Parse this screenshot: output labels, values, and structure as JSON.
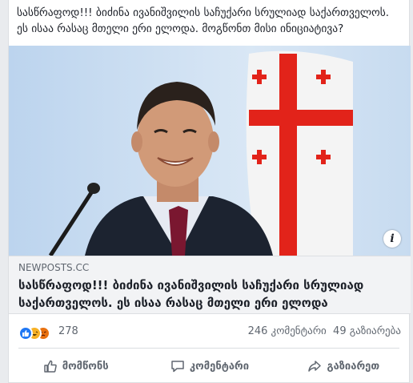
{
  "post": {
    "text": "სასწრაფოდ!!! ბიძინა ივანიშვილის საჩუქარი სრულიად საქართველოს. ეს ისაა რასაც მთელი ერი ელოდა. მოგწონთ მისი ინიციატივა?"
  },
  "media": {
    "info_label": "i"
  },
  "link": {
    "domain": "NEWPOSTS.CC",
    "title": "სასწრაფოდ!!! ბიძინა ივანიშვილის საჩუქარი სრულიად საქართველოს. ეს ისაა რასაც მთელი ერი ელოდა"
  },
  "stats": {
    "reactions_count": "278",
    "comments": "246 კომენტარი",
    "shares": "49 გაზიარება"
  },
  "actions": {
    "like": "მომწონს",
    "comment": "კომენტარი",
    "share": "გაზიარეთ"
  },
  "colors": {
    "facebook_blue": "#2078f4",
    "flag_red": "#e2231a"
  }
}
